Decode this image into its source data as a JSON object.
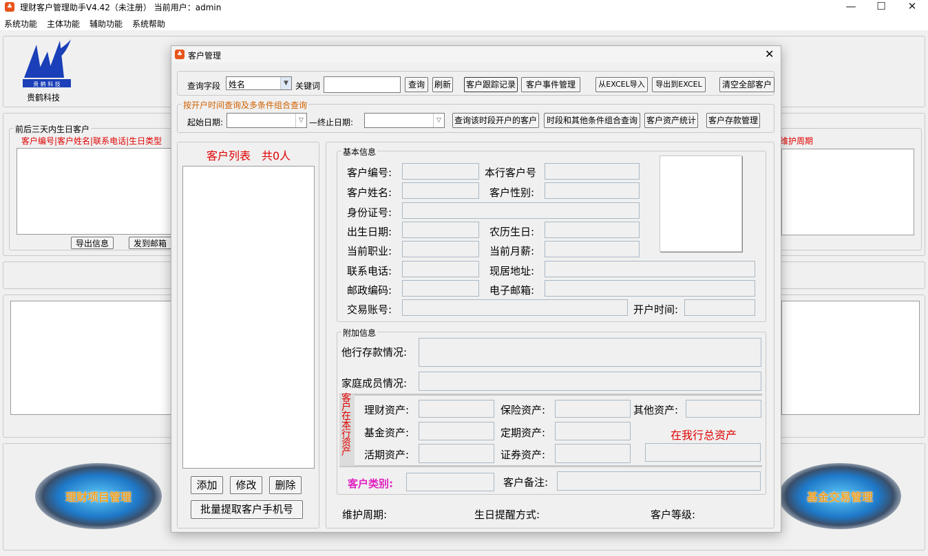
{
  "window": {
    "title": "理财客户管理助手V4.42（未注册）   当前用户：admin",
    "min": "—",
    "max": "☐",
    "close": "✕"
  },
  "menu": [
    "系统功能",
    "主体功能",
    "辅助功能",
    "系统帮助"
  ],
  "logo": {
    "text": "贵鹤科技"
  },
  "birthday": {
    "title": "前后三天内生日客户",
    "columns": "客户编号|客户姓名|联系电话|生日类型",
    "export_label": "导出信息",
    "mail_label": "发到邮箱"
  },
  "right_header": "维护周期",
  "big_buttons": {
    "left": "理财项目管理",
    "right": "基金交易管理"
  },
  "dialog": {
    "title": "客户管理",
    "close": "✕",
    "query": {
      "field_label": "查询字段",
      "field_value": "姓名",
      "keyword_label": "关键词",
      "keyword_value": "",
      "search": "查询",
      "refresh": "刷新",
      "track": "客户跟踪记录",
      "events": "客户事件管理",
      "import": "从EXCEL导入",
      "export": "导出到EXCEL",
      "clear": "清空全部客户"
    },
    "date_group": {
      "title": "按开户时间查询及多条件组合查询",
      "start_label": "起始日期:",
      "end_label": "—终止日期:",
      "start_value": "",
      "end_value": "",
      "btn_period": "查询该时段开户的客户",
      "btn_combo": "时段和其他条件组合查询",
      "btn_assets": "客户资产统计",
      "btn_deposit": "客户存款管理"
    },
    "list": {
      "title": "客户列表",
      "count": "共0人",
      "add": "添加",
      "edit": "修改",
      "delete": "删除",
      "batch": "批量提取客户手机号"
    },
    "basic": {
      "title": "基本信息",
      "id": "客户编号:",
      "bank_id": "本行客户号",
      "name": "客户姓名:",
      "gender": "客户性别:",
      "idcard": "身份证号:",
      "birth": "出生日期:",
      "lunar": "农历生日:",
      "job": "当前职业:",
      "salary": "当前月薪:",
      "phone": "联系电话:",
      "address": "现居地址:",
      "zip": "邮政编码:",
      "email": "电子邮箱:",
      "account": "交易账号:",
      "open_time": "开户时间:"
    },
    "extra": {
      "title": "附加信息",
      "other_deposit": "他行存款情况:",
      "family": "家庭成员情况:",
      "vertical": "客户在本行资产",
      "finance": "理财资产:",
      "insurance": "保险资产:",
      "other": "其他资产:",
      "fund": "基金资产:",
      "fixed": "定期资产:",
      "total": "在我行总资产",
      "current": "活期资产:",
      "securities": "证券资产:",
      "category": "客户类别:",
      "remark": "客户备注:"
    },
    "footer": {
      "cycle": "维护周期:",
      "reminder": "生日提醒方式:",
      "level": "客户等级:"
    }
  }
}
